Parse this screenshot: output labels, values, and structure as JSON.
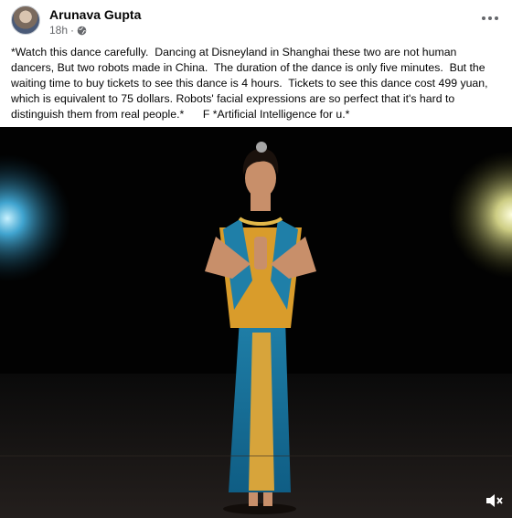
{
  "post": {
    "author": "Arunava Gupta",
    "time": "18h",
    "separator": "·",
    "caption": "*Watch this dance carefully.  Dancing at Disneyland in Shanghai these two are not human dancers, But two robots made in China.  The duration of the dance is only five minutes.  But the waiting time to buy tickets to see this dance is 4 hours.  Tickets to see this dance cost 499 yuan, which is equivalent to 75 dollars. Robots' facial expressions are so perfect that it's hard to distinguish them from real people.*      F *Artificial Intelligence for u.*"
  },
  "icons": {
    "audience": "globe-icon",
    "menu": "more-options-icon",
    "sound": "mute-icon"
  }
}
